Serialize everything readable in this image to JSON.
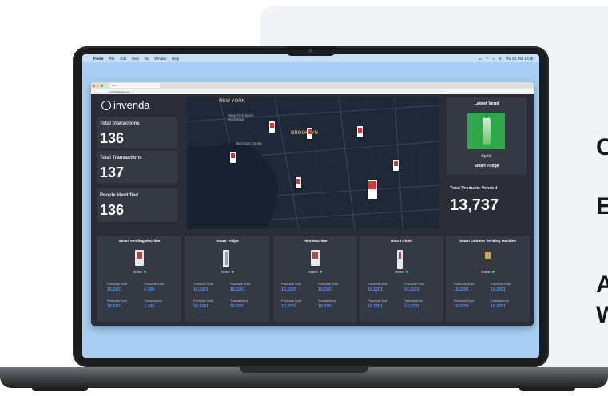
{
  "side_text": [
    "C",
    "E",
    "A",
    "W"
  ],
  "menubar": {
    "apple": "",
    "items": [
      "Finder",
      "File",
      "Edit",
      "View",
      "Go",
      "Window",
      "Help"
    ],
    "datetime": "Thu 23. Feb 10:46"
  },
  "browser": {
    "tab_title": "site",
    "address": "invendagroup.com"
  },
  "dashboard": {
    "logo_text": "invenda",
    "stats": [
      {
        "label": "Total Interactions",
        "value": "136"
      },
      {
        "label": "Total Transactions",
        "value": "137"
      },
      {
        "label": "People Identified",
        "value": "136"
      }
    ],
    "map_labels": [
      "NEW YORK",
      "New York Stock Exchange",
      "Barclays Center",
      "BROOKLYN"
    ],
    "latest_vend": {
      "title": "Latest Vend",
      "product": "Sprite",
      "machine": "Smart Fridge"
    },
    "total_products": {
      "label": "Total Products Vended",
      "value": "13,737"
    },
    "machines": [
      {
        "name": "Smart Vending Machine",
        "status": "Online",
        "l1": "Products Sold",
        "v1": "10,2201",
        "l2": "Products Sold",
        "v2": "4,398",
        "l3": "Products Sold",
        "v3": "10,2201",
        "l4": "Transactions",
        "v4": "1,243"
      },
      {
        "name": "Smart Fridge",
        "status": "Online",
        "l1": "Products Sold",
        "v1": "10,2201",
        "l2": "Products Sold",
        "v2": "10,2201",
        "l3": "Products Sold",
        "v3": "10,2201",
        "l4": "Transactions",
        "v4": "10,2201"
      },
      {
        "name": "AMS Machine",
        "status": "Online",
        "l1": "Products Sold",
        "v1": "10,2203",
        "l2": "Products Sold",
        "v2": "10,2201",
        "l3": "Products Sold",
        "v3": "10,2201",
        "l4": "Transactions",
        "v4": "10,2201"
      },
      {
        "name": "Smart Kiosk",
        "status": "Online",
        "l1": "Products Sold",
        "v1": "10,2201",
        "l2": "Products Sold",
        "v2": "10,2201",
        "l3": "Products Sold",
        "v3": "10,2201",
        "l4": "Transactions",
        "v4": "10,2201"
      },
      {
        "name": "Smart Outdoor Vending Machine",
        "status": "Online",
        "l1": "Products Sold",
        "v1": "10,2201",
        "l2": "Products Sold",
        "v2": "10,2201",
        "l3": "Products Sold",
        "v3": "10,2201",
        "l4": "Transactions",
        "v4": "10,2201"
      }
    ]
  },
  "colors": {
    "accent_blue": "#4c8fff",
    "online_green": "#38d05a",
    "dashboard_bg": "#2a2d36",
    "card_bg": "#353944",
    "sprite_green": "#2ea84b"
  }
}
